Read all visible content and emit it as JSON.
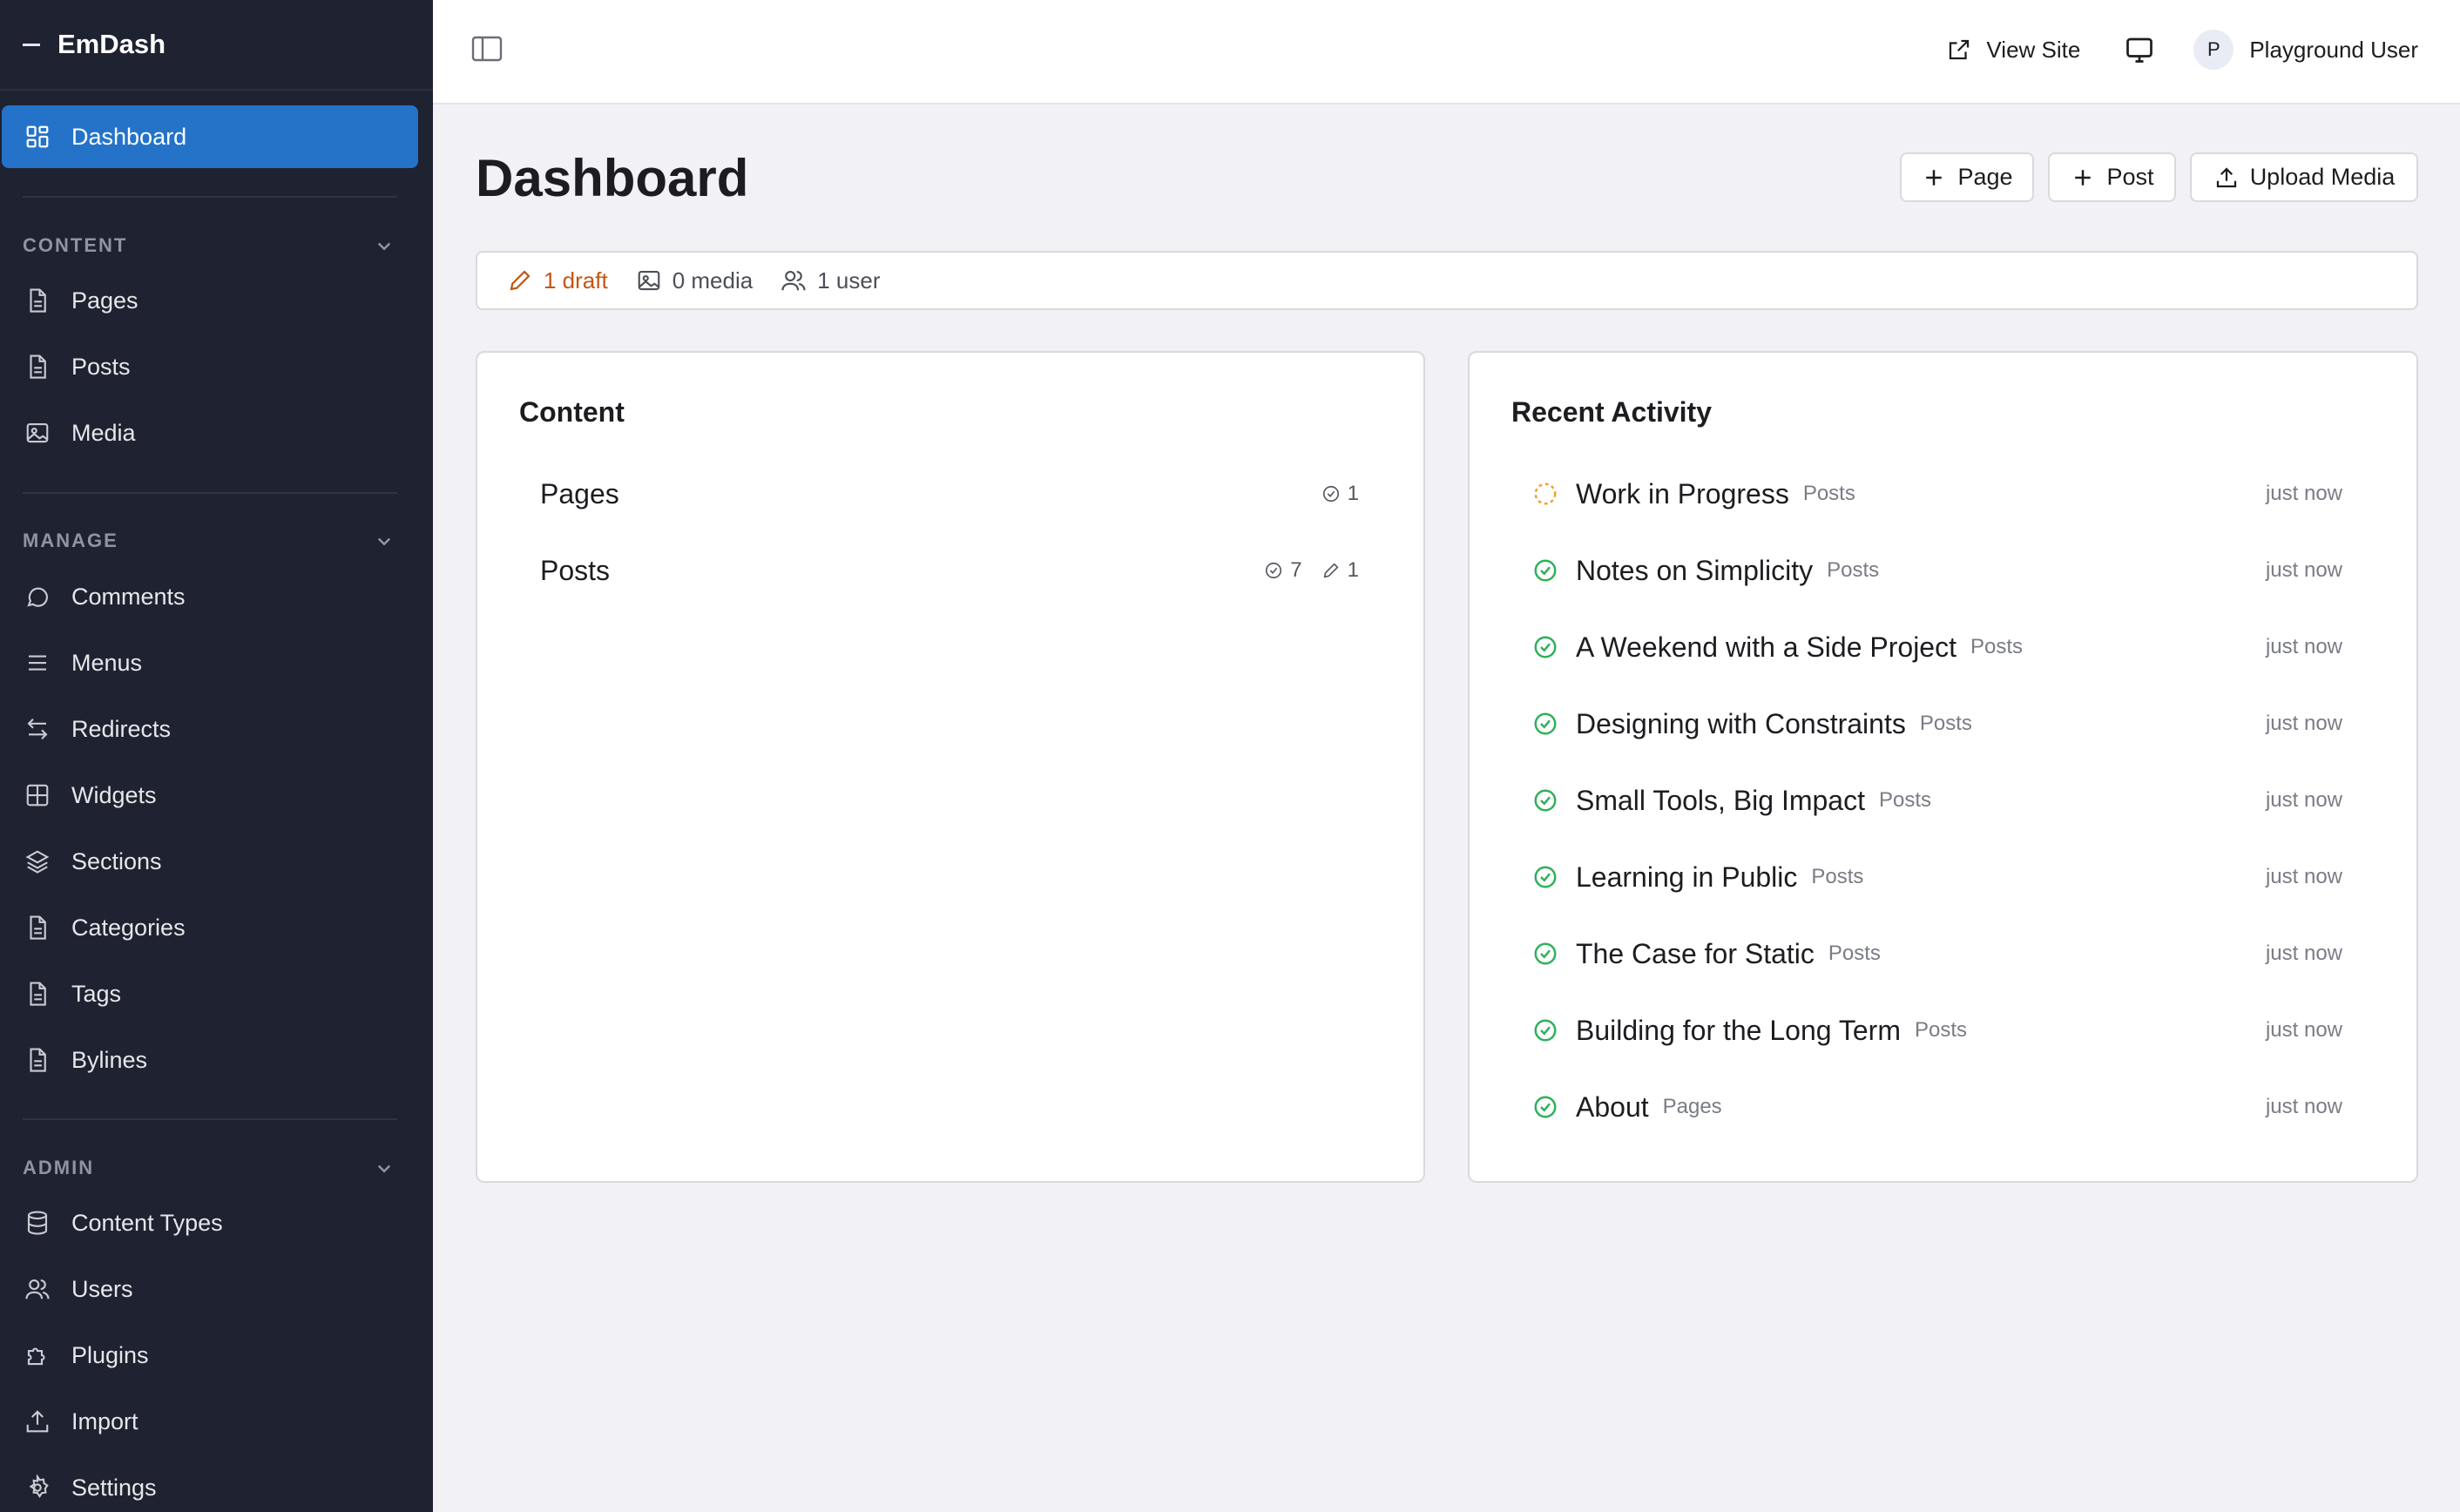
{
  "sidebar": {
    "brand": "EmDash",
    "active_item": {
      "label": "Dashboard",
      "icon": "dashboard-grid-icon"
    },
    "sections": [
      {
        "heading": "CONTENT",
        "items": [
          {
            "label": "Pages",
            "icon": "page-icon"
          },
          {
            "label": "Posts",
            "icon": "page-icon"
          },
          {
            "label": "Media",
            "icon": "image-icon"
          }
        ]
      },
      {
        "heading": "MANAGE",
        "items": [
          {
            "label": "Comments",
            "icon": "comment-icon"
          },
          {
            "label": "Menus",
            "icon": "menu-lines-icon"
          },
          {
            "label": "Redirects",
            "icon": "redirect-arrows-icon"
          },
          {
            "label": "Widgets",
            "icon": "widgets-grid-icon"
          },
          {
            "label": "Sections",
            "icon": "layers-icon"
          },
          {
            "label": "Categories",
            "icon": "page-icon"
          },
          {
            "label": "Tags",
            "icon": "page-icon"
          },
          {
            "label": "Bylines",
            "icon": "page-icon"
          }
        ]
      },
      {
        "heading": "ADMIN",
        "items": [
          {
            "label": "Content Types",
            "icon": "database-icon"
          },
          {
            "label": "Users",
            "icon": "users-icon"
          },
          {
            "label": "Plugins",
            "icon": "puzzle-icon"
          },
          {
            "label": "Import",
            "icon": "upload-icon"
          },
          {
            "label": "Settings",
            "icon": "gear-icon"
          }
        ]
      }
    ]
  },
  "topbar": {
    "view_site": "View Site",
    "avatar_initial": "P",
    "user_name": "Playground User"
  },
  "main": {
    "title": "Dashboard",
    "actions": {
      "page": "Page",
      "post": "Post",
      "upload": "Upload Media"
    },
    "stats": {
      "drafts": "1 draft",
      "media": "0 media",
      "users": "1 user"
    },
    "content_card": {
      "title": "Content",
      "rows": [
        {
          "name": "Pages",
          "published": "1",
          "drafts": ""
        },
        {
          "name": "Posts",
          "published": "7",
          "drafts": "1"
        }
      ]
    },
    "activity_card": {
      "title": "Recent Activity",
      "items": [
        {
          "title": "Work in Progress",
          "type": "Posts",
          "when": "just now",
          "status": "draft"
        },
        {
          "title": "Notes on Simplicity",
          "type": "Posts",
          "when": "just now",
          "status": "published"
        },
        {
          "title": "A Weekend with a Side Project",
          "type": "Posts",
          "when": "just now",
          "status": "published"
        },
        {
          "title": "Designing with Constraints",
          "type": "Posts",
          "when": "just now",
          "status": "published"
        },
        {
          "title": "Small Tools, Big Impact",
          "type": "Posts",
          "when": "just now",
          "status": "published"
        },
        {
          "title": "Learning in Public",
          "type": "Posts",
          "when": "just now",
          "status": "published"
        },
        {
          "title": "The Case for Static",
          "type": "Posts",
          "when": "just now",
          "status": "published"
        },
        {
          "title": "Building for the Long Term",
          "type": "Posts",
          "when": "just now",
          "status": "published"
        },
        {
          "title": "About",
          "type": "Pages",
          "when": "just now",
          "status": "published"
        }
      ]
    }
  },
  "colors": {
    "sidebar_bg": "#1f2230",
    "accent": "#2473c9",
    "draft": "#c45512",
    "published": "#2fb05a",
    "pending": "#f0a22a"
  }
}
